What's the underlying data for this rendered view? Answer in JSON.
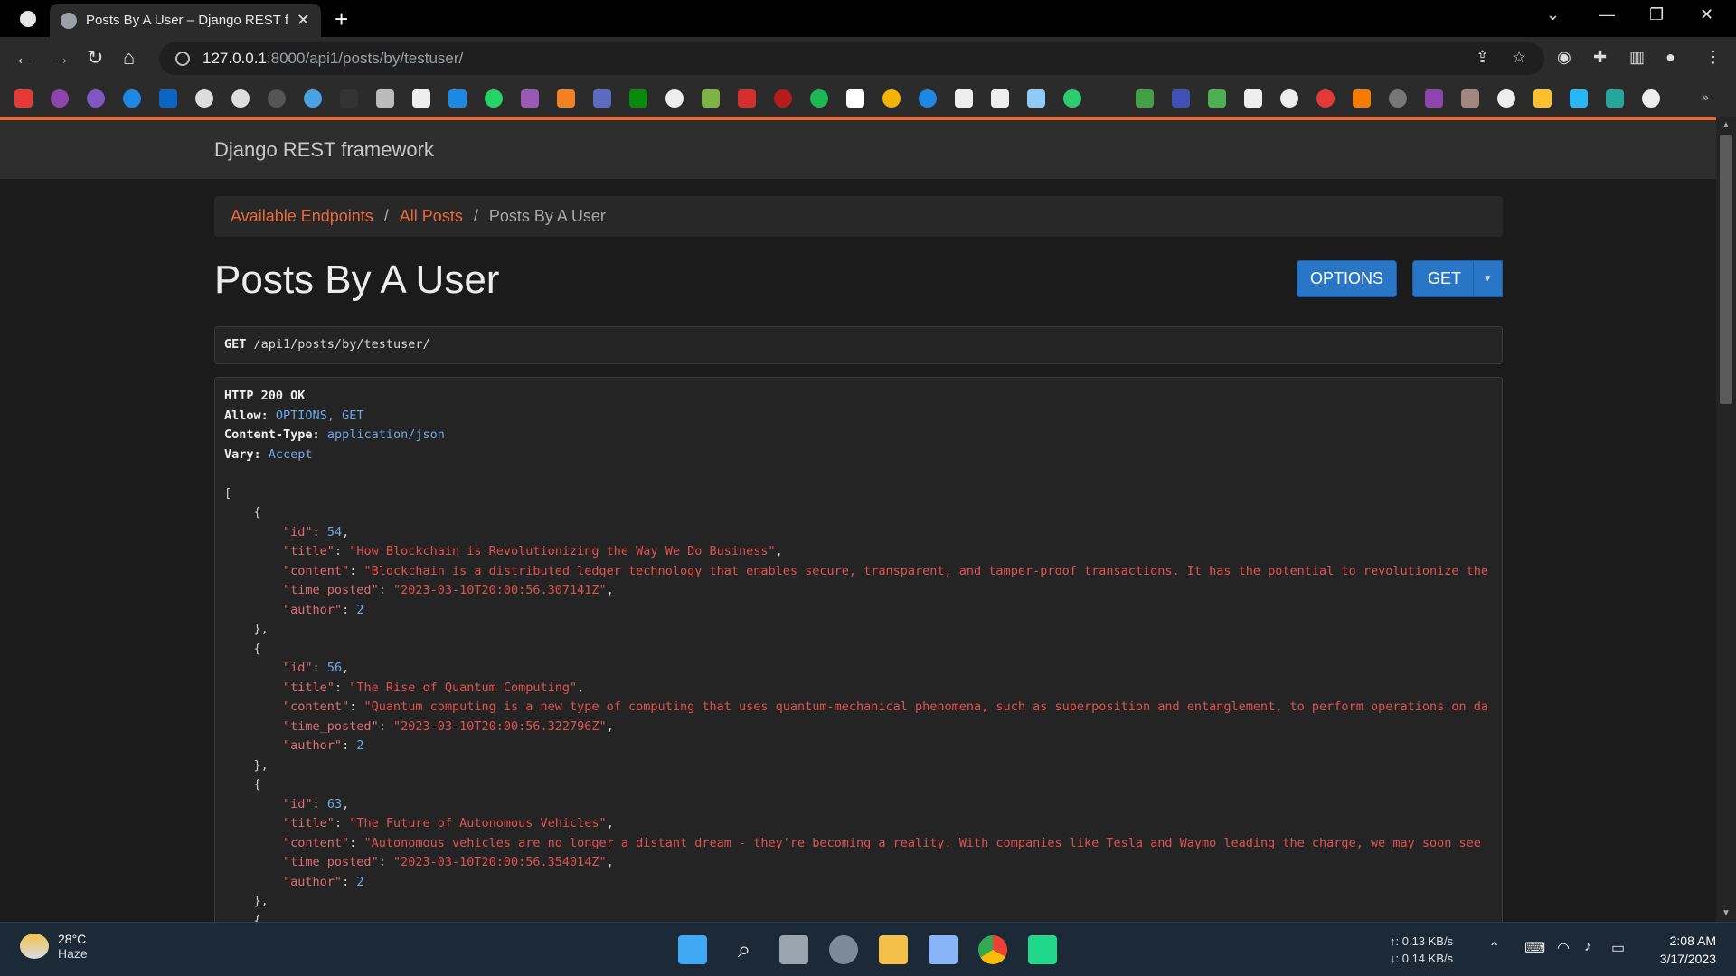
{
  "browser": {
    "tab_title": "Posts By A User – Django REST fr",
    "url_host": "127.0.0.1",
    "url_rest": ":8000/api1/posts/by/testuser/"
  },
  "navbar": {
    "brand": "Django REST framework"
  },
  "breadcrumb": {
    "items": [
      "Available Endpoints",
      "All Posts",
      "Posts By A User"
    ],
    "separator": "/"
  },
  "page": {
    "title": "Posts By A User",
    "options_label": "OPTIONS",
    "get_label": "GET"
  },
  "request": {
    "method": "GET",
    "path": "/api1/posts/by/testuser/"
  },
  "response": {
    "status": "HTTP 200 OK",
    "headers": [
      {
        "name": "Allow:",
        "value": "OPTIONS, GET"
      },
      {
        "name": "Content-Type:",
        "value": "application/json"
      },
      {
        "name": "Vary:",
        "value": "Accept"
      }
    ],
    "posts": [
      {
        "id": "54",
        "title": "\"How Blockchain is Revolutionizing the Way We Do Business\"",
        "content": "\"Blockchain is a distributed ledger technology that enables secure, transparent, and tamper-proof transactions. It has the potential to revolutionize the",
        "time_posted": "\"2023-03-10T20:00:56.307141Z\"",
        "author": "2"
      },
      {
        "id": "56",
        "title": "\"The Rise of Quantum Computing\"",
        "content": "\"Quantum computing is a new type of computing that uses quantum-mechanical phenomena, such as superposition and entanglement, to perform operations on da",
        "time_posted": "\"2023-03-10T20:00:56.322796Z\"",
        "author": "2"
      },
      {
        "id": "63",
        "title": "\"The Future of Autonomous Vehicles\"",
        "content": "\"Autonomous vehicles are no longer a distant dream - they're becoming a reality. With companies like Tesla and Waymo leading the charge, we may soon see",
        "time_posted": "\"2023-03-10T20:00:56.354014Z\"",
        "author": "2"
      }
    ]
  },
  "taskbar": {
    "temperature": "28°C",
    "weather": "Haze",
    "upload": "↑: 0.13 KB/s",
    "download": "↓: 0.14 KB/s",
    "time": "2:08 AM",
    "date": "3/17/2023"
  },
  "colors": {
    "accent_orange": "#e8693a",
    "button_blue": "#2a76c6",
    "json_key": "#e06c75",
    "json_string": "#e05252",
    "json_number": "#6ea8e8"
  }
}
